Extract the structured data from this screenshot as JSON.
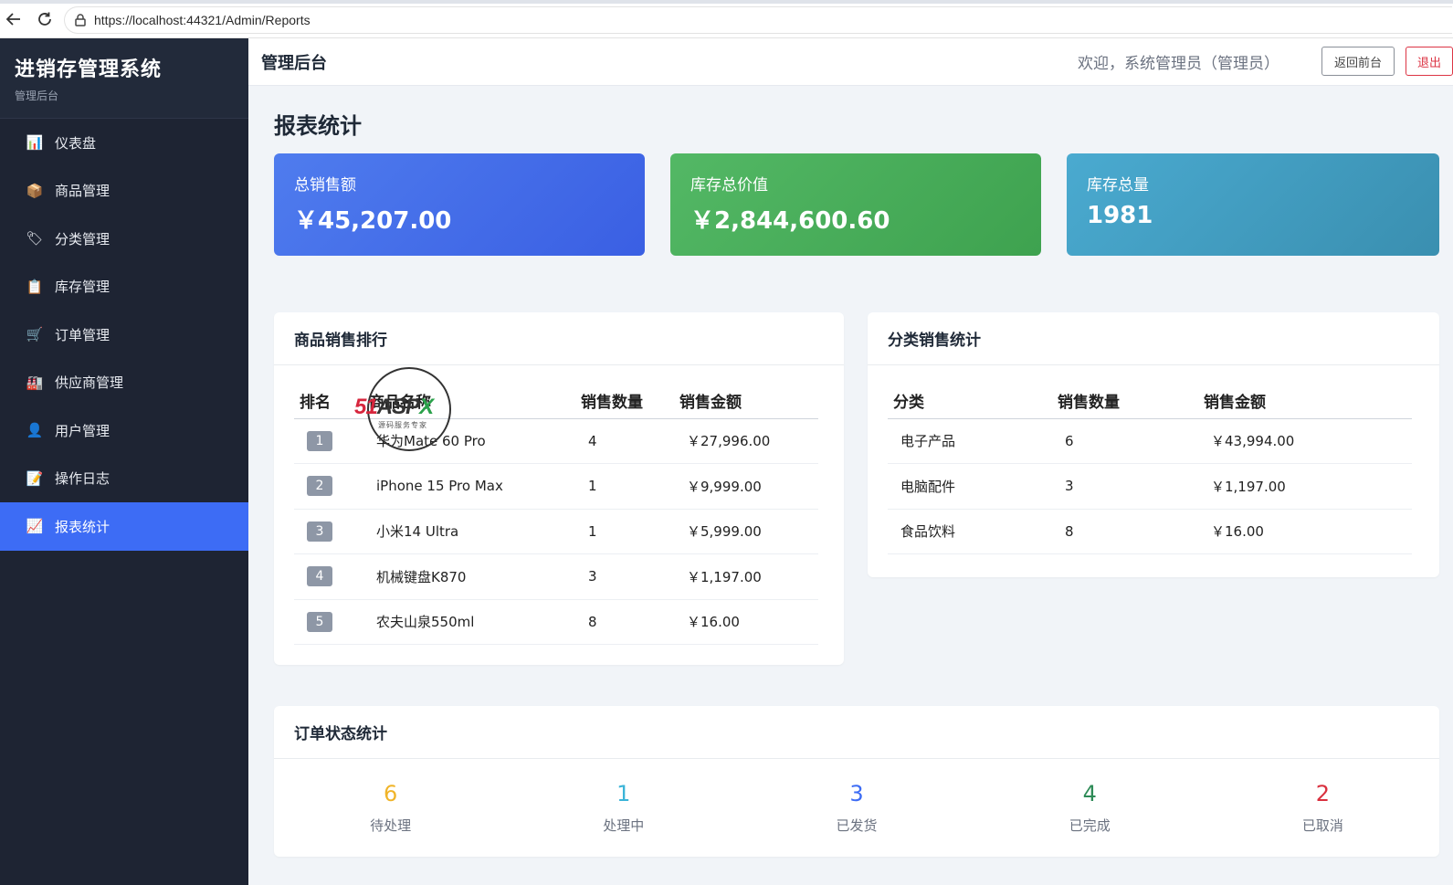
{
  "browser": {
    "url": "https://localhost:44321/Admin/Reports"
  },
  "sidebar": {
    "brand_title": "进销存管理系统",
    "brand_subtitle": "管理后台",
    "items": [
      {
        "label": "仪表盘",
        "icon": "📊"
      },
      {
        "label": "商品管理",
        "icon": "📦"
      },
      {
        "label": "分类管理",
        "icon": "🏷"
      },
      {
        "label": "库存管理",
        "icon": "📋"
      },
      {
        "label": "订单管理",
        "icon": "🛒"
      },
      {
        "label": "供应商管理",
        "icon": "🏭"
      },
      {
        "label": "用户管理",
        "icon": "👤"
      },
      {
        "label": "操作日志",
        "icon": "📝"
      },
      {
        "label": "报表统计",
        "icon": "📈"
      }
    ],
    "active_index": 8
  },
  "header": {
    "title": "管理后台",
    "welcome": "欢迎，系统管理员（管理员）",
    "front_button": "返回前台",
    "logout_button": "退出"
  },
  "main": {
    "page_title": "报表统计",
    "stats": [
      {
        "label": "总销售额",
        "value": "￥45,207.00"
      },
      {
        "label": "库存总价值",
        "value": "￥2,844,600.60"
      },
      {
        "label": "库存总量",
        "value": "1981"
      }
    ],
    "ranking": {
      "title": "商品销售排行",
      "headers": [
        "排名",
        "商品名称",
        "销售数量",
        "销售金额"
      ],
      "rows": [
        {
          "rank": "1",
          "name": "华为Mate 60 Pro",
          "qty": "4",
          "amount": "￥27,996.00"
        },
        {
          "rank": "2",
          "name": "iPhone 15 Pro Max",
          "qty": "1",
          "amount": "￥9,999.00"
        },
        {
          "rank": "3",
          "name": "小米14 Ultra",
          "qty": "1",
          "amount": "￥5,999.00"
        },
        {
          "rank": "4",
          "name": "机械键盘K870",
          "qty": "3",
          "amount": "￥1,197.00"
        },
        {
          "rank": "5",
          "name": "农夫山泉550ml",
          "qty": "8",
          "amount": "￥16.00"
        }
      ]
    },
    "category": {
      "title": "分类销售统计",
      "headers": [
        "分类",
        "销售数量",
        "销售金额"
      ],
      "rows": [
        {
          "name": "电子产品",
          "qty": "6",
          "amount": "￥43,994.00"
        },
        {
          "name": "电脑配件",
          "qty": "3",
          "amount": "￥1,197.00"
        },
        {
          "name": "食品饮料",
          "qty": "8",
          "amount": "￥16.00"
        }
      ]
    },
    "orders": {
      "title": "订单状态统计",
      "items": [
        {
          "count": "6",
          "label": "待处理",
          "color": "#f0b429"
        },
        {
          "count": "1",
          "label": "处理中",
          "color": "#3bb4d8"
        },
        {
          "count": "3",
          "label": "已发货",
          "color": "#3d6cf5"
        },
        {
          "count": "4",
          "label": "已完成",
          "color": "#2e8b57"
        },
        {
          "count": "2",
          "label": "已取消",
          "color": "#d9303e"
        }
      ]
    }
  },
  "watermark": {
    "brand_red": "51",
    "brand_mid": "ASP",
    "brand_green": "X",
    "sub": "源码服务专家"
  }
}
